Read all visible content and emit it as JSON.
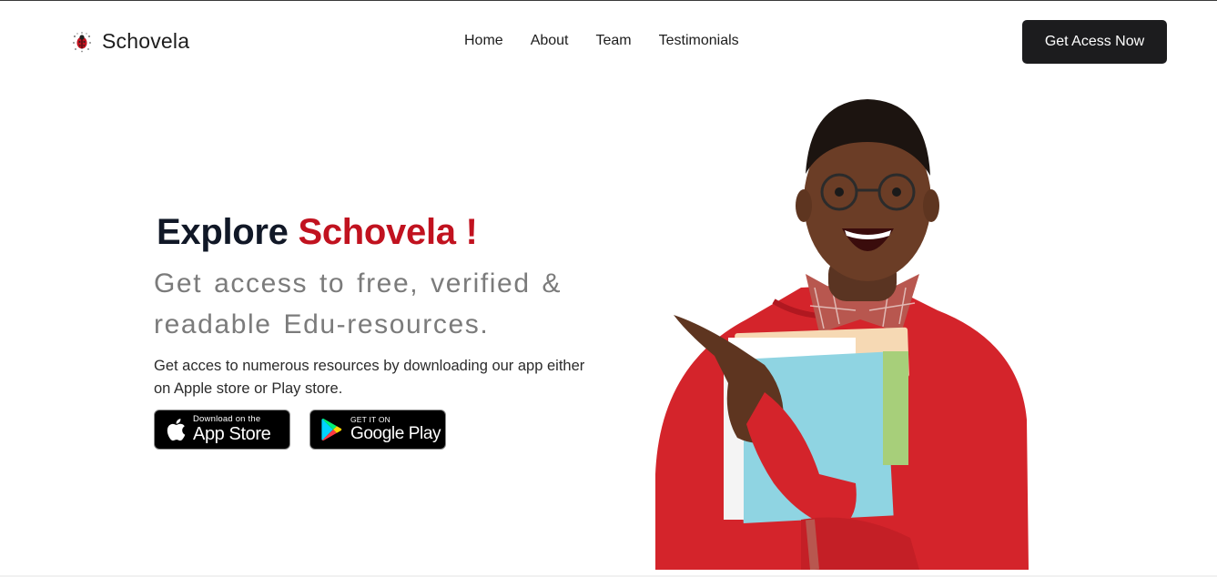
{
  "brand": {
    "name": "Schovela",
    "logo_icon": "ladybug-icon"
  },
  "nav": {
    "links": [
      "Home",
      "About",
      "Team",
      "Testimonials"
    ],
    "cta_label": "Get Acess Now"
  },
  "hero": {
    "title_prefix": "Explore",
    "title_brand": "Schovela !",
    "subtitle": "Get access to free, verified & readable Edu-resources.",
    "description": "Get acces to numerous resources by downloading our app either on Apple store or Play store.",
    "app_store": {
      "small": "Download on the",
      "big": "App Store"
    },
    "google_play": {
      "small": "GET IT ON",
      "big": "Google Play"
    }
  },
  "colors": {
    "accent": "#c1121f",
    "cta_bg": "#1c1c1e",
    "subtitle": "#7b7b7b"
  }
}
